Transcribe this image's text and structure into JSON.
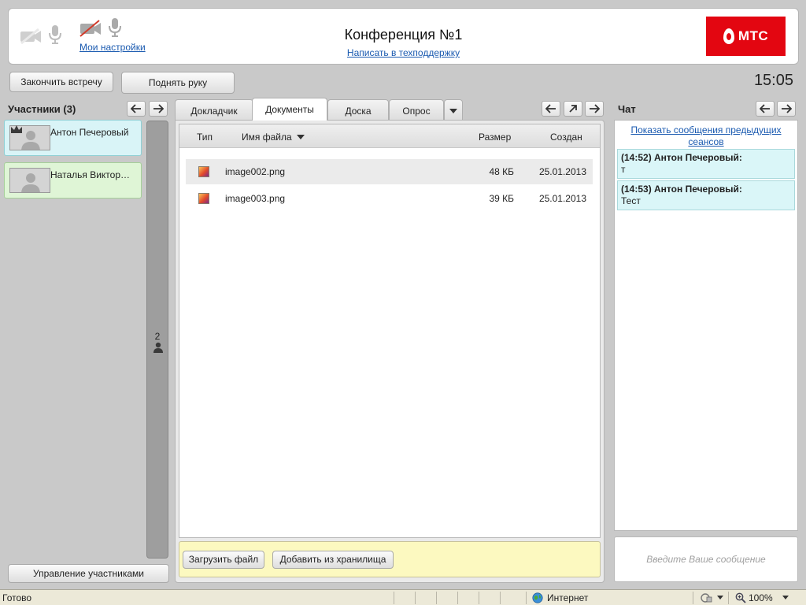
{
  "header": {
    "my_settings": "Мои настройки",
    "title": "Конференция №1",
    "support_link": "Написать в техподдержку",
    "logo_text": "МТС",
    "brand_color": "#e30611"
  },
  "toolbar": {
    "end_meeting": "Закончить встречу",
    "raise_hand": "Поднять руку",
    "time": "15:05"
  },
  "participants": {
    "title": "Участники (3)",
    "items": [
      {
        "name": "Антон Печеровый",
        "bg": "#d9f4f7",
        "border": "#8fcfd4",
        "crown": true
      },
      {
        "name": "Наталья Виктор…",
        "bg": "#dff5d6",
        "border": "#a6cf9a",
        "crown": false
      }
    ],
    "side_count": "2",
    "manage_button": "Управление участниками"
  },
  "tabs": [
    {
      "label": "Докладчик"
    },
    {
      "label": "Документы"
    },
    {
      "label": "Доска"
    },
    {
      "label": "Опрос"
    }
  ],
  "documents": {
    "columns": {
      "type": "Тип",
      "name": "Имя файла",
      "size": "Размер",
      "created": "Создан"
    },
    "files": [
      {
        "name": "image002.png",
        "size": "48 КБ",
        "created": "25.01.2013",
        "selected": true
      },
      {
        "name": "image003.png",
        "size": "39 КБ",
        "created": "25.01.2013",
        "selected": false
      }
    ],
    "upload_button": "Загрузить файл",
    "add_from_storage_button": "Добавить из хранилища"
  },
  "chat": {
    "title": "Чат",
    "show_previous": "Показать сообщения предыдущих сеансов",
    "messages": [
      {
        "header": "(14:52) Антон Печеровый:",
        "text": "т"
      },
      {
        "header": "(14:53) Антон Печеровый:",
        "text": "Тест"
      }
    ],
    "input_placeholder": "Введите Ваше сообщение"
  },
  "statusbar": {
    "status": "Готово",
    "zone": "Интернет",
    "zoom": "100%"
  }
}
